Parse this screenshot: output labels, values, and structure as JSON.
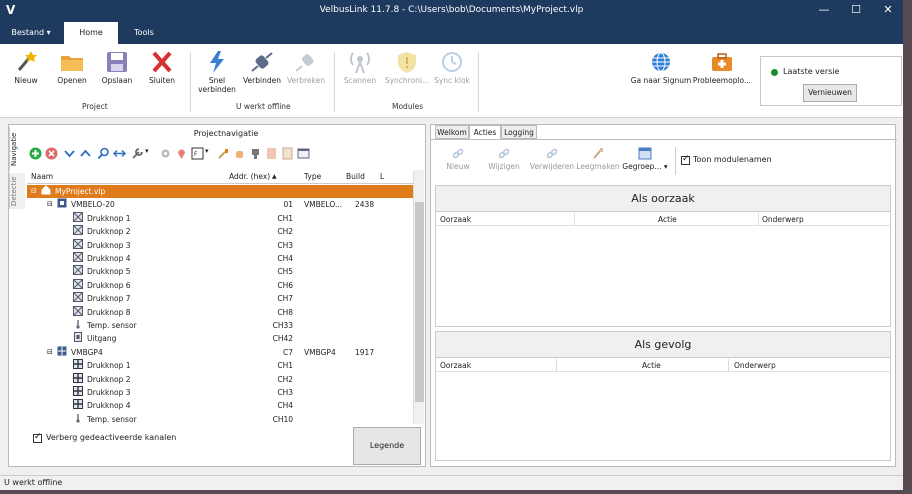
{
  "window": {
    "title": "VelbusLink 11.7.8 - C:\\Users\\bob\\Documents\\MyProject.vlp",
    "logo": "V"
  },
  "ribbon_tabs": [
    {
      "label": "Bestand"
    },
    {
      "label": "Home"
    },
    {
      "label": "Tools"
    }
  ],
  "ribbon": {
    "project": {
      "group_label": "Project",
      "new": "Nieuw",
      "open": "Openen",
      "save": "Opslaan",
      "close": "Sluiten"
    },
    "offline": {
      "group_label": "U werkt offline",
      "quick_connect": "Snel verbinden",
      "connect": "Verbinden",
      "disconnect": "Verbreken"
    },
    "modules": {
      "group_label": "Modules",
      "scan": "Scannen",
      "sync": "Synchroni...",
      "sync_clock": "Sync klok"
    },
    "signum": "Ga naar Signum",
    "troubleshoot": "Probleemoplo...",
    "version": {
      "status": "Laatste versie",
      "refresh": "Vernieuwen",
      "status_color": "#1a8a2a"
    }
  },
  "side_tabs": {
    "navigation": "Navigatie",
    "detection": "Detectie"
  },
  "project_nav": {
    "title": "Projectnavigatie",
    "columns": {
      "name": "Naam",
      "addr": "Addr. (hex)",
      "type": "Type",
      "build": "Build",
      "l": "L"
    },
    "rows": [
      {
        "name": "MyProject.vlp",
        "addr": "",
        "type": "",
        "build": ""
      },
      {
        "name": "VMBELO-20",
        "addr": "01",
        "type": "VMBELO...",
        "build": "2438"
      },
      {
        "name": "Drukknop 1",
        "addr": "CH1",
        "type": "",
        "build": ""
      },
      {
        "name": "Drukknop 2",
        "addr": "CH2",
        "type": "",
        "build": ""
      },
      {
        "name": "Drukknop 3",
        "addr": "CH3",
        "type": "",
        "build": ""
      },
      {
        "name": "Drukknop 4",
        "addr": "CH4",
        "type": "",
        "build": ""
      },
      {
        "name": "Drukknop 5",
        "addr": "CH5",
        "type": "",
        "build": ""
      },
      {
        "name": "Drukknop 6",
        "addr": "CH6",
        "type": "",
        "build": ""
      },
      {
        "name": "Drukknop 7",
        "addr": "CH7",
        "type": "",
        "build": ""
      },
      {
        "name": "Drukknop 8",
        "addr": "CH8",
        "type": "",
        "build": ""
      },
      {
        "name": "Temp. sensor",
        "addr": "CH33",
        "type": "",
        "build": ""
      },
      {
        "name": "Uitgang",
        "addr": "CH42",
        "type": "",
        "build": ""
      },
      {
        "name": "VMBGP4",
        "addr": "C7",
        "type": "VMBGP4",
        "build": "1917"
      },
      {
        "name": "Drukknop 1",
        "addr": "CH1",
        "type": "",
        "build": ""
      },
      {
        "name": "Drukknop 2",
        "addr": "CH2",
        "type": "",
        "build": ""
      },
      {
        "name": "Drukknop 3",
        "addr": "CH3",
        "type": "",
        "build": ""
      },
      {
        "name": "Drukknop 4",
        "addr": "CH4",
        "type": "",
        "build": ""
      },
      {
        "name": "Temp. sensor",
        "addr": "CH10",
        "type": "",
        "build": ""
      }
    ],
    "hide_disabled": "Verberg gedeactiveerde kanalen",
    "legend_button": "Legende"
  },
  "right_tabs": [
    {
      "label": "Welkom"
    },
    {
      "label": "Acties"
    },
    {
      "label": "Logging"
    }
  ],
  "actions_toolbar": {
    "new": "Nieuw",
    "edit": "Wijzigen",
    "delete": "Verwijderen",
    "clear": "Leegmaken",
    "grouped": "Gegroep...",
    "show_names": "Toon modulenamen"
  },
  "cause": {
    "title": "Als oorzaak",
    "col_cause": "Oorzaak",
    "col_action": "Actie",
    "col_subject": "Onderwerp"
  },
  "effect": {
    "title": "Als gevolg",
    "col_cause": "Oorzaak",
    "col_action": "Actie",
    "col_subject": "Onderwerp"
  },
  "status": {
    "text": "U werkt offline"
  }
}
